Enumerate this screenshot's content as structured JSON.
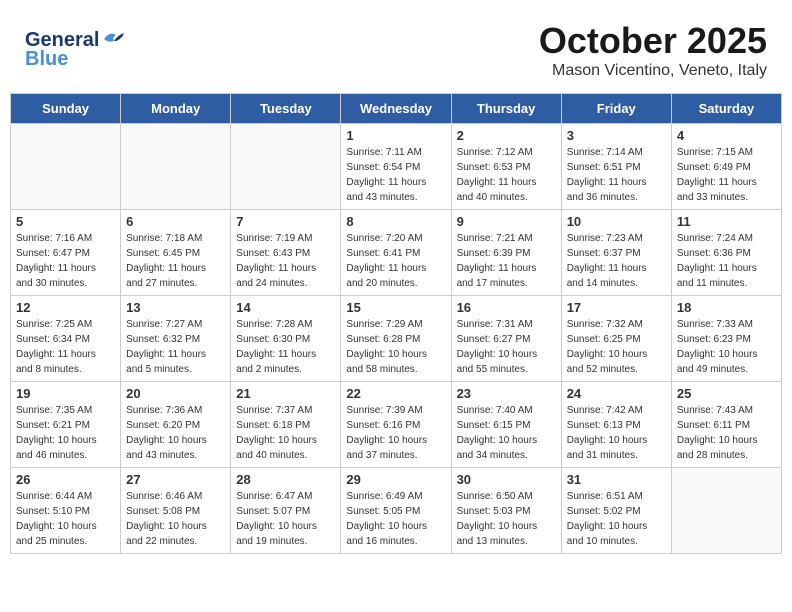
{
  "header": {
    "logo_general": "General",
    "logo_blue": "Blue",
    "month_title": "October 2025",
    "location": "Mason Vicentino, Veneto, Italy"
  },
  "weekdays": [
    "Sunday",
    "Monday",
    "Tuesday",
    "Wednesday",
    "Thursday",
    "Friday",
    "Saturday"
  ],
  "weeks": [
    [
      {
        "day": "",
        "info": ""
      },
      {
        "day": "",
        "info": ""
      },
      {
        "day": "",
        "info": ""
      },
      {
        "day": "1",
        "info": "Sunrise: 7:11 AM\nSunset: 6:54 PM\nDaylight: 11 hours\nand 43 minutes."
      },
      {
        "day": "2",
        "info": "Sunrise: 7:12 AM\nSunset: 6:53 PM\nDaylight: 11 hours\nand 40 minutes."
      },
      {
        "day": "3",
        "info": "Sunrise: 7:14 AM\nSunset: 6:51 PM\nDaylight: 11 hours\nand 36 minutes."
      },
      {
        "day": "4",
        "info": "Sunrise: 7:15 AM\nSunset: 6:49 PM\nDaylight: 11 hours\nand 33 minutes."
      }
    ],
    [
      {
        "day": "5",
        "info": "Sunrise: 7:16 AM\nSunset: 6:47 PM\nDaylight: 11 hours\nand 30 minutes."
      },
      {
        "day": "6",
        "info": "Sunrise: 7:18 AM\nSunset: 6:45 PM\nDaylight: 11 hours\nand 27 minutes."
      },
      {
        "day": "7",
        "info": "Sunrise: 7:19 AM\nSunset: 6:43 PM\nDaylight: 11 hours\nand 24 minutes."
      },
      {
        "day": "8",
        "info": "Sunrise: 7:20 AM\nSunset: 6:41 PM\nDaylight: 11 hours\nand 20 minutes."
      },
      {
        "day": "9",
        "info": "Sunrise: 7:21 AM\nSunset: 6:39 PM\nDaylight: 11 hours\nand 17 minutes."
      },
      {
        "day": "10",
        "info": "Sunrise: 7:23 AM\nSunset: 6:37 PM\nDaylight: 11 hours\nand 14 minutes."
      },
      {
        "day": "11",
        "info": "Sunrise: 7:24 AM\nSunset: 6:36 PM\nDaylight: 11 hours\nand 11 minutes."
      }
    ],
    [
      {
        "day": "12",
        "info": "Sunrise: 7:25 AM\nSunset: 6:34 PM\nDaylight: 11 hours\nand 8 minutes."
      },
      {
        "day": "13",
        "info": "Sunrise: 7:27 AM\nSunset: 6:32 PM\nDaylight: 11 hours\nand 5 minutes."
      },
      {
        "day": "14",
        "info": "Sunrise: 7:28 AM\nSunset: 6:30 PM\nDaylight: 11 hours\nand 2 minutes."
      },
      {
        "day": "15",
        "info": "Sunrise: 7:29 AM\nSunset: 6:28 PM\nDaylight: 10 hours\nand 58 minutes."
      },
      {
        "day": "16",
        "info": "Sunrise: 7:31 AM\nSunset: 6:27 PM\nDaylight: 10 hours\nand 55 minutes."
      },
      {
        "day": "17",
        "info": "Sunrise: 7:32 AM\nSunset: 6:25 PM\nDaylight: 10 hours\nand 52 minutes."
      },
      {
        "day": "18",
        "info": "Sunrise: 7:33 AM\nSunset: 6:23 PM\nDaylight: 10 hours\nand 49 minutes."
      }
    ],
    [
      {
        "day": "19",
        "info": "Sunrise: 7:35 AM\nSunset: 6:21 PM\nDaylight: 10 hours\nand 46 minutes."
      },
      {
        "day": "20",
        "info": "Sunrise: 7:36 AM\nSunset: 6:20 PM\nDaylight: 10 hours\nand 43 minutes."
      },
      {
        "day": "21",
        "info": "Sunrise: 7:37 AM\nSunset: 6:18 PM\nDaylight: 10 hours\nand 40 minutes."
      },
      {
        "day": "22",
        "info": "Sunrise: 7:39 AM\nSunset: 6:16 PM\nDaylight: 10 hours\nand 37 minutes."
      },
      {
        "day": "23",
        "info": "Sunrise: 7:40 AM\nSunset: 6:15 PM\nDaylight: 10 hours\nand 34 minutes."
      },
      {
        "day": "24",
        "info": "Sunrise: 7:42 AM\nSunset: 6:13 PM\nDaylight: 10 hours\nand 31 minutes."
      },
      {
        "day": "25",
        "info": "Sunrise: 7:43 AM\nSunset: 6:11 PM\nDaylight: 10 hours\nand 28 minutes."
      }
    ],
    [
      {
        "day": "26",
        "info": "Sunrise: 6:44 AM\nSunset: 5:10 PM\nDaylight: 10 hours\nand 25 minutes."
      },
      {
        "day": "27",
        "info": "Sunrise: 6:46 AM\nSunset: 5:08 PM\nDaylight: 10 hours\nand 22 minutes."
      },
      {
        "day": "28",
        "info": "Sunrise: 6:47 AM\nSunset: 5:07 PM\nDaylight: 10 hours\nand 19 minutes."
      },
      {
        "day": "29",
        "info": "Sunrise: 6:49 AM\nSunset: 5:05 PM\nDaylight: 10 hours\nand 16 minutes."
      },
      {
        "day": "30",
        "info": "Sunrise: 6:50 AM\nSunset: 5:03 PM\nDaylight: 10 hours\nand 13 minutes."
      },
      {
        "day": "31",
        "info": "Sunrise: 6:51 AM\nSunset: 5:02 PM\nDaylight: 10 hours\nand 10 minutes."
      },
      {
        "day": "",
        "info": ""
      }
    ]
  ]
}
